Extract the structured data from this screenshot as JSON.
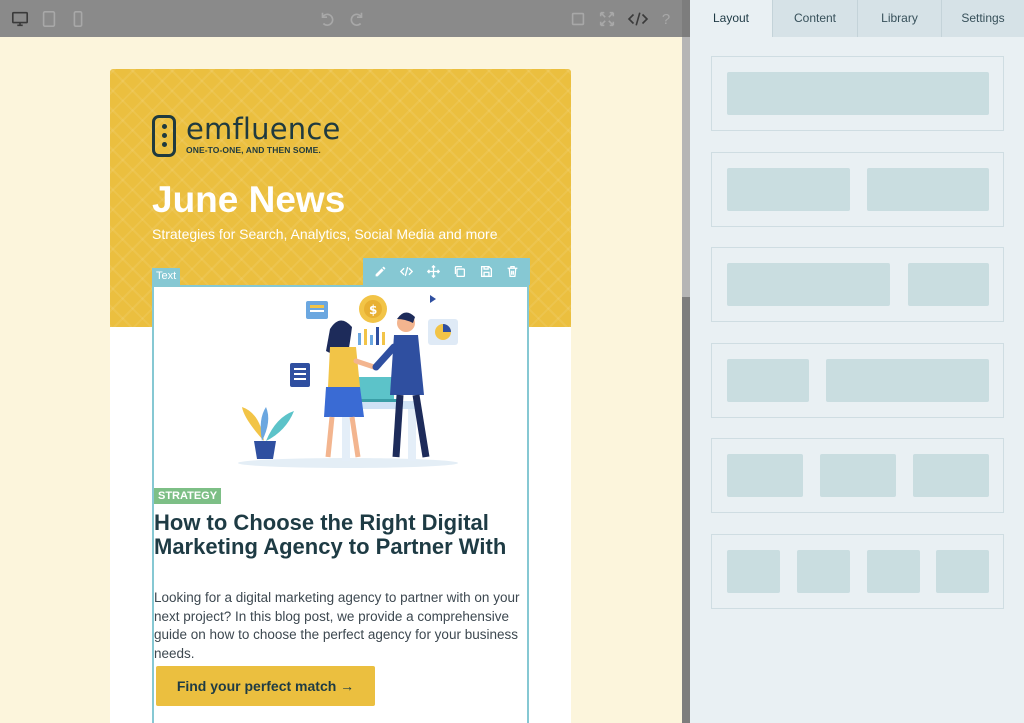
{
  "toolbar": {
    "devices": [
      "desktop-icon",
      "tablet-icon",
      "mobile-icon"
    ],
    "history": [
      "undo-icon",
      "redo-icon"
    ],
    "actions": [
      "square-icon",
      "fullscreen-icon",
      "code-icon",
      "help-icon"
    ]
  },
  "email": {
    "brand": {
      "name": "emfluence",
      "tagline": "ONE-TO-ONE, AND THEN SOME."
    },
    "hero": {
      "title": "June News",
      "subtitle": "Strategies for Search, Analytics, Social Media and more"
    },
    "selected_block": {
      "label": "Text",
      "tools": [
        "pencil-icon",
        "code-icon",
        "move-icon",
        "duplicate-icon",
        "save-icon",
        "trash-icon"
      ]
    },
    "article": {
      "tag": "STRATEGY",
      "title": "How to Choose the Right Digital Marketing Agency to Partner With",
      "body": "Looking for a digital marketing agency to partner with on your next project? In this blog post, we provide a comprehensive guide on how to choose the perfect agency for your business needs.",
      "cta": "Find your perfect match →"
    }
  },
  "panel": {
    "tabs": [
      {
        "label": "Layout",
        "active": true
      },
      {
        "label": "Content",
        "active": false
      },
      {
        "label": "Library",
        "active": false
      },
      {
        "label": "Settings",
        "active": false
      }
    ],
    "layouts": [
      "1 column",
      "2 columns equal",
      "2 columns wide-narrow",
      "2 columns narrow-wide",
      "3 columns",
      "4 columns"
    ]
  },
  "colors": {
    "hero_yellow": "#ebbf3f",
    "accent_teal": "#86c8d3",
    "title_dark": "#1e3b44",
    "tag_green": "#7dbf86",
    "canvas_bg": "#fcf5dc"
  }
}
